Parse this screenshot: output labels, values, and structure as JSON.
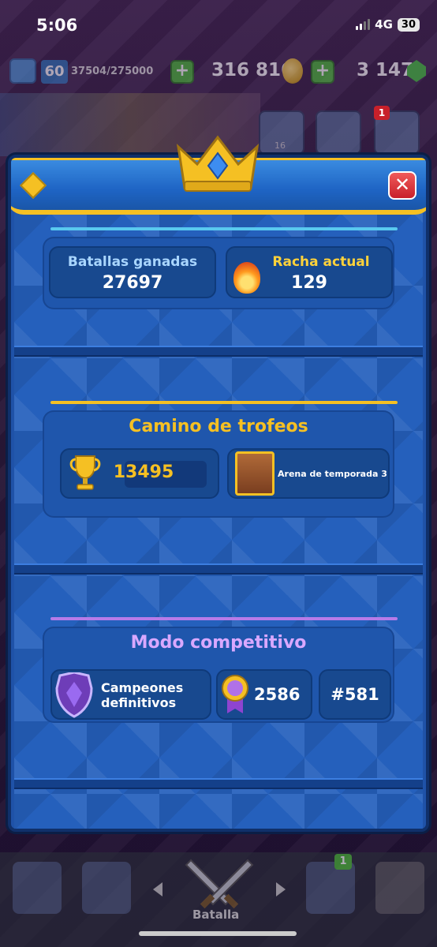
{
  "status": {
    "time": "5:06",
    "network": "4G",
    "battery": "30"
  },
  "resources": {
    "level": "60",
    "xp": "37504/275000",
    "gold": "316 816",
    "gems": "3 147",
    "notification_count": "1"
  },
  "modal": {
    "battles_won_label": "Batallas ganadas",
    "battles_won_value": "27697",
    "streak_label": "Racha actual",
    "streak_value": "129",
    "trophy_road_title": "Camino de trofeos",
    "trophies": "13495",
    "arena": "Arena de temporada 3",
    "competitive_title": "Modo competitivo",
    "league": "Campeones definitivos",
    "medals": "2586",
    "rank": "#581"
  },
  "friends_count": "16",
  "bottom_nav": {
    "battle_label": "Batalla",
    "clan_badge": "1"
  },
  "colors": {
    "gold": "#f5c023",
    "panel_blue": "#2560bc",
    "cyan_line": "#59c9ef",
    "purple_line": "#b77be8",
    "close_red": "#c8202a"
  }
}
